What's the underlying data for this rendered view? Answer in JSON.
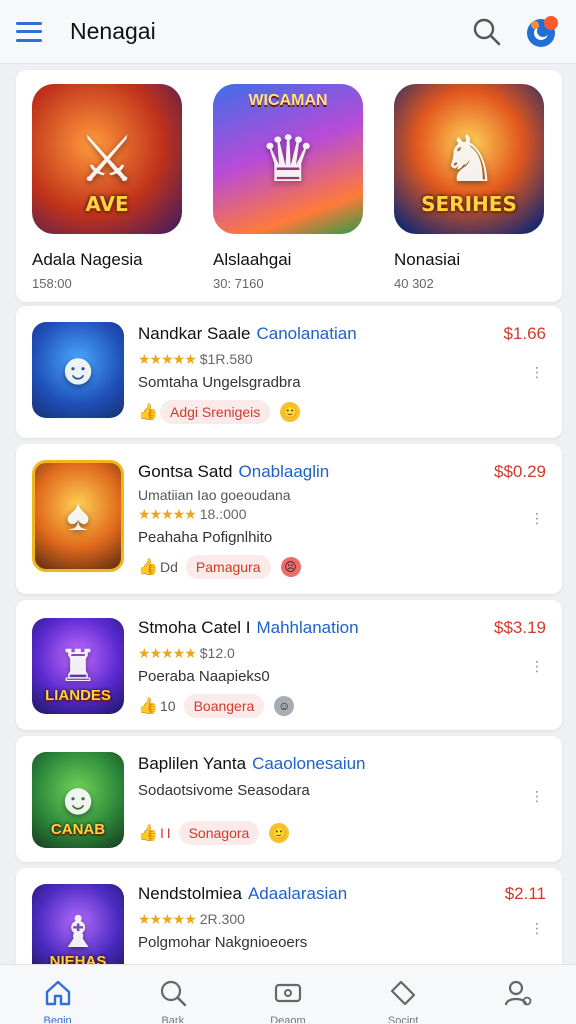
{
  "header": {
    "title": "Nenagai",
    "menu_icon": "hamburger-menu-icon",
    "search_icon": "search-icon",
    "profile_icon": "profile-badge-icon"
  },
  "featured": [
    {
      "name": "Adala Nagesia",
      "meta": "158:00",
      "banner": "AVE",
      "top_banner": "",
      "icon": "hero-character-icon"
    },
    {
      "name": "Alslaahgai",
      "meta": "30: 7160",
      "banner": "",
      "top_banner": "WICAMAN",
      "icon": "adventure-party-icon"
    },
    {
      "name": "Nonasiai",
      "meta": "40 302",
      "banner": "SERIHES",
      "top_banner": "",
      "icon": "wolf-warrior-icon"
    }
  ],
  "apps": [
    {
      "name": "Nandkar Saale",
      "developer": "Canolanatian",
      "price": "$1.66",
      "stars": "★★★★★",
      "rating": "$1R.580",
      "subtitle": "Somtaha Ungelsgradbra",
      "count": "",
      "tag": "Adgi Srenigeis",
      "emoji": "🙂",
      "banner": ""
    },
    {
      "name": "Gontsa Satd",
      "developer": "Onablaaglin",
      "price": "$$0.29",
      "stars": "★★★★★",
      "rating": "18.:000",
      "subtitle": "Peahaha Pofignlhito",
      "extra": "Umatiian Iao goeoudana",
      "count": "Dd",
      "tag": "Pamagura",
      "emoji": "🙂",
      "banner": ""
    },
    {
      "name": "Stmoha Catel I",
      "developer": "Mahhlanation",
      "price": "$$3.19",
      "stars": "★★★★★",
      "rating": "$12.0",
      "subtitle": "Poeraba Naapieks0",
      "count": "10",
      "tag": "Boangera",
      "emoji": "🙂",
      "banner": "LIANDES"
    },
    {
      "name": "Baplilen Yanta",
      "developer": "Caaolonesaiun",
      "price": "",
      "stars": "",
      "rating": "",
      "subtitle": "Sodaotsivome Seasodara",
      "count": "I I",
      "tag": "Sonagora",
      "emoji": "🙂",
      "banner": "CANAB"
    },
    {
      "name": "Nendstolmiea",
      "developer": "Adaalarasian",
      "price": "$2.11",
      "stars": "★★★★★",
      "rating": "2R.300",
      "subtitle": "Polgmohar Nakgnioeoers",
      "count": "",
      "tag": "",
      "emoji": "",
      "banner": "NIEHAS"
    }
  ],
  "nav": [
    {
      "label": "Begin",
      "icon": "home-icon"
    },
    {
      "label": "Bark",
      "icon": "search-icon"
    },
    {
      "label": "Deaom",
      "icon": "ticket-icon"
    },
    {
      "label": "Socint",
      "icon": "tag-icon"
    },
    {
      "label": "",
      "icon": "account-settings-icon"
    }
  ],
  "colors": {
    "accent": "#2f6fd6",
    "price": "#d23a2a",
    "developer": "#1c62c8",
    "star": "#e9a81c"
  }
}
